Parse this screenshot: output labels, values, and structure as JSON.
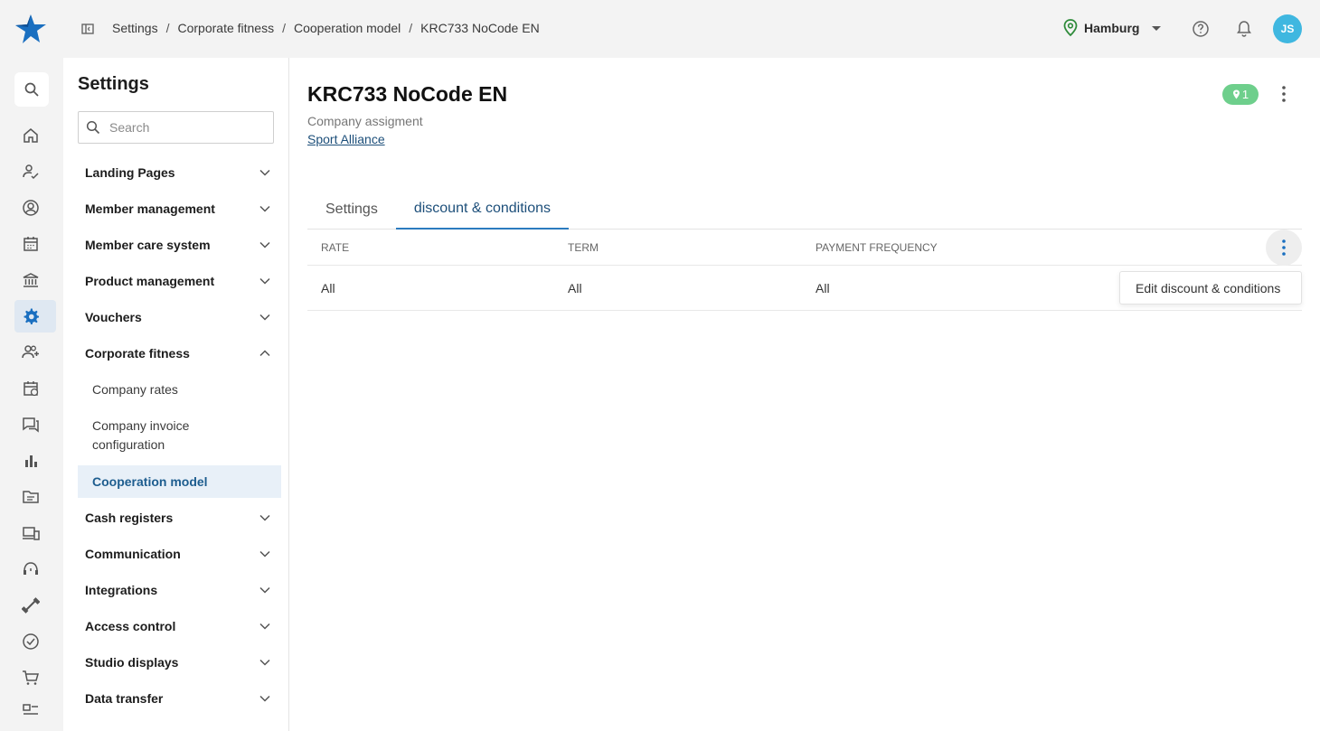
{
  "breadcrumb": {
    "items": [
      "Settings",
      "Corporate fitness",
      "Cooperation model",
      "KRC733 NoCode EN"
    ],
    "separator": "/"
  },
  "header": {
    "location": "Hamburg",
    "avatar_initials": "JS",
    "avatar_color": "#3fb7e0"
  },
  "rail": {
    "icons": [
      "search-icon",
      "home-icon",
      "user-check-icon",
      "account-icon",
      "calendar-icon",
      "bank-icon",
      "settings-icon",
      "add-user-icon",
      "calendar-sync-icon",
      "chat-icon",
      "bar-chart-icon",
      "folder-icon",
      "devices-icon",
      "headset-icon",
      "dumbbell-icon",
      "check-circle-icon",
      "cart-icon",
      "reviews-icon"
    ],
    "active": "settings-icon"
  },
  "settings": {
    "title": "Settings",
    "search_placeholder": "Search",
    "groups": [
      {
        "label": "Landing Pages",
        "expanded": false
      },
      {
        "label": "Member management",
        "expanded": false
      },
      {
        "label": "Member care system",
        "expanded": false
      },
      {
        "label": "Product management",
        "expanded": false
      },
      {
        "label": "Vouchers",
        "expanded": false
      },
      {
        "label": "Corporate fitness",
        "expanded": true
      },
      {
        "label": "Cash registers",
        "expanded": false
      },
      {
        "label": "Communication",
        "expanded": false
      },
      {
        "label": "Integrations",
        "expanded": false
      },
      {
        "label": "Access control",
        "expanded": false
      },
      {
        "label": "Studio displays",
        "expanded": false
      },
      {
        "label": "Data transfer",
        "expanded": false
      }
    ],
    "corporate_fitness_items": [
      "Company rates",
      "Company invoice configuration",
      "Cooperation model"
    ],
    "active_item": "Cooperation model"
  },
  "main": {
    "title": "KRC733 NoCode EN",
    "sub_label": "Company assigment",
    "company_link": "Sport Alliance",
    "badge_count": "1",
    "badge_color": "#6ecf8c",
    "tabs": [
      {
        "label": "Settings",
        "active": false
      },
      {
        "label": "discount & conditions",
        "active": true
      }
    ],
    "table": {
      "headers": [
        "RATE",
        "TERM",
        "PAYMENT FREQUENCY"
      ],
      "rows": [
        [
          "All",
          "All",
          "All"
        ]
      ]
    },
    "row_menu": {
      "items": [
        "Edit discount & conditions"
      ]
    }
  },
  "colors": {
    "accent": "#2b7bbf",
    "active_bg": "#e8f0f8",
    "link": "#1d4f7a"
  }
}
